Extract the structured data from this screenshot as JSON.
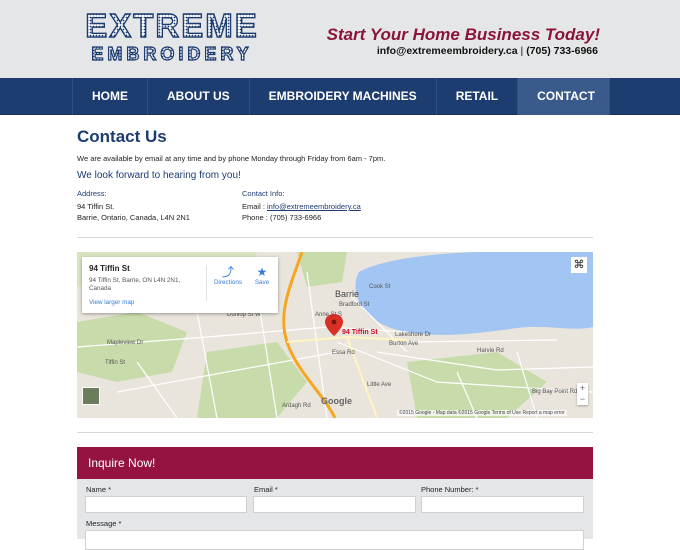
{
  "header": {
    "logo_line1": "EXTREME",
    "logo_line2": "EMBROIDERY",
    "tagline": "Start Your Home Business Today!",
    "email": "info@extremeembroidery.ca",
    "separator": "|",
    "phone": "(705) 733-6966"
  },
  "nav": {
    "items": [
      {
        "label": "HOME"
      },
      {
        "label": "ABOUT US"
      },
      {
        "label": "EMBROIDERY MACHINES"
      },
      {
        "label": "RETAIL"
      },
      {
        "label": "CONTACT"
      }
    ],
    "active": "CONTACT"
  },
  "main": {
    "title": "Contact Us",
    "intro": "We are available by email at any time and by phone Monday through Friday from 6am - 7pm.",
    "look_forward": "We look forward to hearing from you!",
    "address": {
      "heading": "Address:",
      "line1": "94 Tiffin St.",
      "line2": "Barrie, Ontario, Canada, L4N 2N1"
    },
    "contact_info": {
      "heading": "Contact Info:",
      "email_label": "Email : ",
      "email": "info@extremeembroidery.ca",
      "phone_label": "Phone : ",
      "phone": "(705) 733-6966"
    }
  },
  "map": {
    "place_title": "94 Tiffin St",
    "place_address": "94 Tiffin St, Barrie, ON L4N 2N1, Canada",
    "view_larger": "View larger map",
    "directions": "Directions",
    "save": "Save",
    "pin_label": "94 Tiffin St",
    "city_label": "Barrie",
    "street_labels": [
      "Tiffin St",
      "Dunlop St W",
      "Burton Ave",
      "Essa Rd",
      "Lakeshore Dr",
      "Little Ave",
      "Big Bay Point Rd",
      "Anne St S",
      "Ardagh Rd",
      "Mapleview Dr",
      "Bradford St",
      "Harvie Rd",
      "Cook St"
    ],
    "google": "Google",
    "attribution": "©2015 Google - Map data ©2015 Google   Terms of Use   Report a map error",
    "zoom_in": "+",
    "zoom_out": "−",
    "colors": {
      "water": "#a3c5f3",
      "land": "#e9e5dc",
      "park": "#c8dcab",
      "highway": "#f5a623",
      "road": "#ffffff",
      "pin": "#d93025"
    }
  },
  "form": {
    "header": "Inquire Now!",
    "name_label": "Name *",
    "email_label": "Email *",
    "phone_label": "Phone Number: *",
    "message_label": "Message *"
  },
  "colors": {
    "brand_blue": "#1d3c70",
    "brand_maroon": "#941340",
    "tagline": "#8a1538",
    "header_bg": "#e4e6e8"
  }
}
